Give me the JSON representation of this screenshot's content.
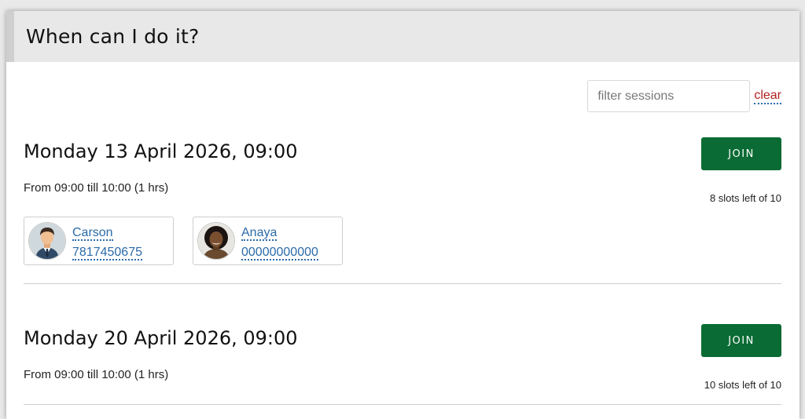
{
  "header": {
    "title": "When can I do it?"
  },
  "filter": {
    "placeholder": "filter sessions",
    "clear_label": "clear"
  },
  "sessions": [
    {
      "date": "Monday 13 April 2026, 09:00",
      "time_range": "From 09:00 till 10:00 (1 hrs)",
      "join_label": "JOIN",
      "slots_text": "8 slots left of 10",
      "attendees": [
        {
          "name": "Carson",
          "phone": "7817450675",
          "avatar_icon": "man-avatar-icon"
        },
        {
          "name": "Anaya",
          "phone": "00000000000",
          "avatar_icon": "woman-avatar-icon"
        }
      ]
    },
    {
      "date": "Monday 20 April 2026, 09:00",
      "time_range": "From 09:00 till 10:00 (1 hrs)",
      "join_label": "JOIN",
      "slots_text": "10 slots left of 10",
      "attendees": []
    }
  ],
  "colors": {
    "join_button": "#0a6b34",
    "link": "#2b6aa8",
    "clear_link": "#b32020",
    "header_bg": "#e8e8e8"
  }
}
